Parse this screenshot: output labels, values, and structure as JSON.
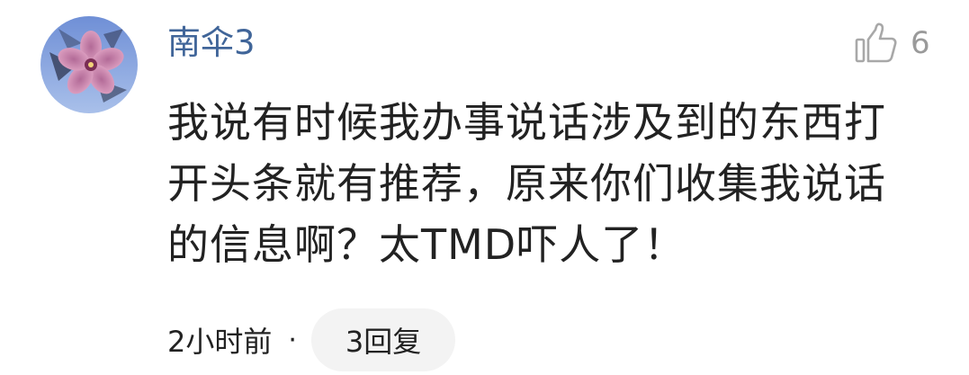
{
  "comment": {
    "username": "南伞3",
    "like_icon": "thumbs-up-icon",
    "like_count": "6",
    "text": "我说有时候我办事说话涉及到的东西打开头条就有推荐，原来你们收集我说话的信息啊？太TMD吓人了！",
    "time": "2小时前",
    "separator": "·",
    "reply_label": "3回复"
  },
  "colors": {
    "username": "#406599",
    "text": "#222222",
    "muted": "#9a9a9a",
    "reply_bg": "#f3f3f3"
  }
}
